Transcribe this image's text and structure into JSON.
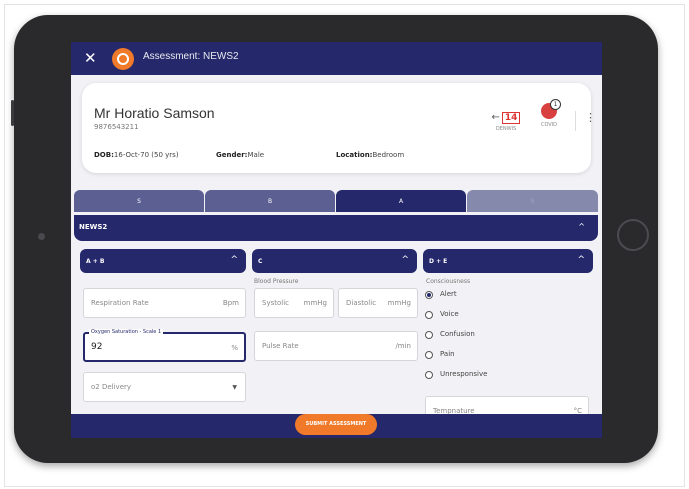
{
  "header": {
    "close_glyph": "✕",
    "title": "Assessment: NEWS2"
  },
  "patient": {
    "name": "Mr Horatio Samson",
    "id": "9876543211",
    "dob_label": "DOB:",
    "dob_value": "16-Oct-70 (50 yrs)",
    "gender_label": "Gender:",
    "gender_value": "Male",
    "location_label": "Location:",
    "location_value": "Bedroom",
    "denwis_arrow": "←",
    "denwis_count": "14",
    "denwis_label": "DENWIS",
    "covid_badge": "1",
    "covid_label": "COVID",
    "menu_glyph": "⋮"
  },
  "tabs": [
    {
      "label": "S"
    },
    {
      "label": "B"
    },
    {
      "label": "A"
    },
    {
      "label": "R"
    }
  ],
  "news2": {
    "title": "NEWS2",
    "chevron": "^"
  },
  "sections": {
    "ab": {
      "title": "A + B",
      "chevron": "^"
    },
    "c": {
      "title": "C",
      "chevron": "^"
    },
    "de": {
      "title": "D + E",
      "chevron": "^"
    }
  },
  "ab": {
    "resp_placeholder": "Respiration Rate",
    "resp_unit": "Bpm",
    "spo2_label": "Oxygen Saturation - Scale 1",
    "spo2_value": "92",
    "spo2_unit": "%",
    "o2_placeholder": "o2 Delivery",
    "o2_caret": "▼"
  },
  "c": {
    "bp_label": "Blood Pressure",
    "systolic_placeholder": "Systolic",
    "systolic_unit": "mmHg",
    "diastolic_placeholder": "Diastolic",
    "diastolic_unit": "mmHg",
    "pulse_placeholder": "Pulse Rate",
    "pulse_unit": "/min"
  },
  "de": {
    "consciousness_label": "Consciousness",
    "options": [
      "Alert",
      "Voice",
      "Confusion",
      "Pain",
      "Unresponsive"
    ],
    "selected": "Alert",
    "temp_placeholder": "Tempnature",
    "temp_unit": "°C"
  },
  "footer": {
    "submit_label": "SUBMIT ASSESSMENT"
  },
  "colors": {
    "primary": "#25296b",
    "accent": "#f07a2a",
    "alert": "#d33333"
  },
  "icons": [
    "close-icon",
    "logo-icon",
    "arrow-left-icon",
    "virus-icon",
    "kebab-menu-icon",
    "chevron-up-icon",
    "dropdown-caret-icon"
  ]
}
